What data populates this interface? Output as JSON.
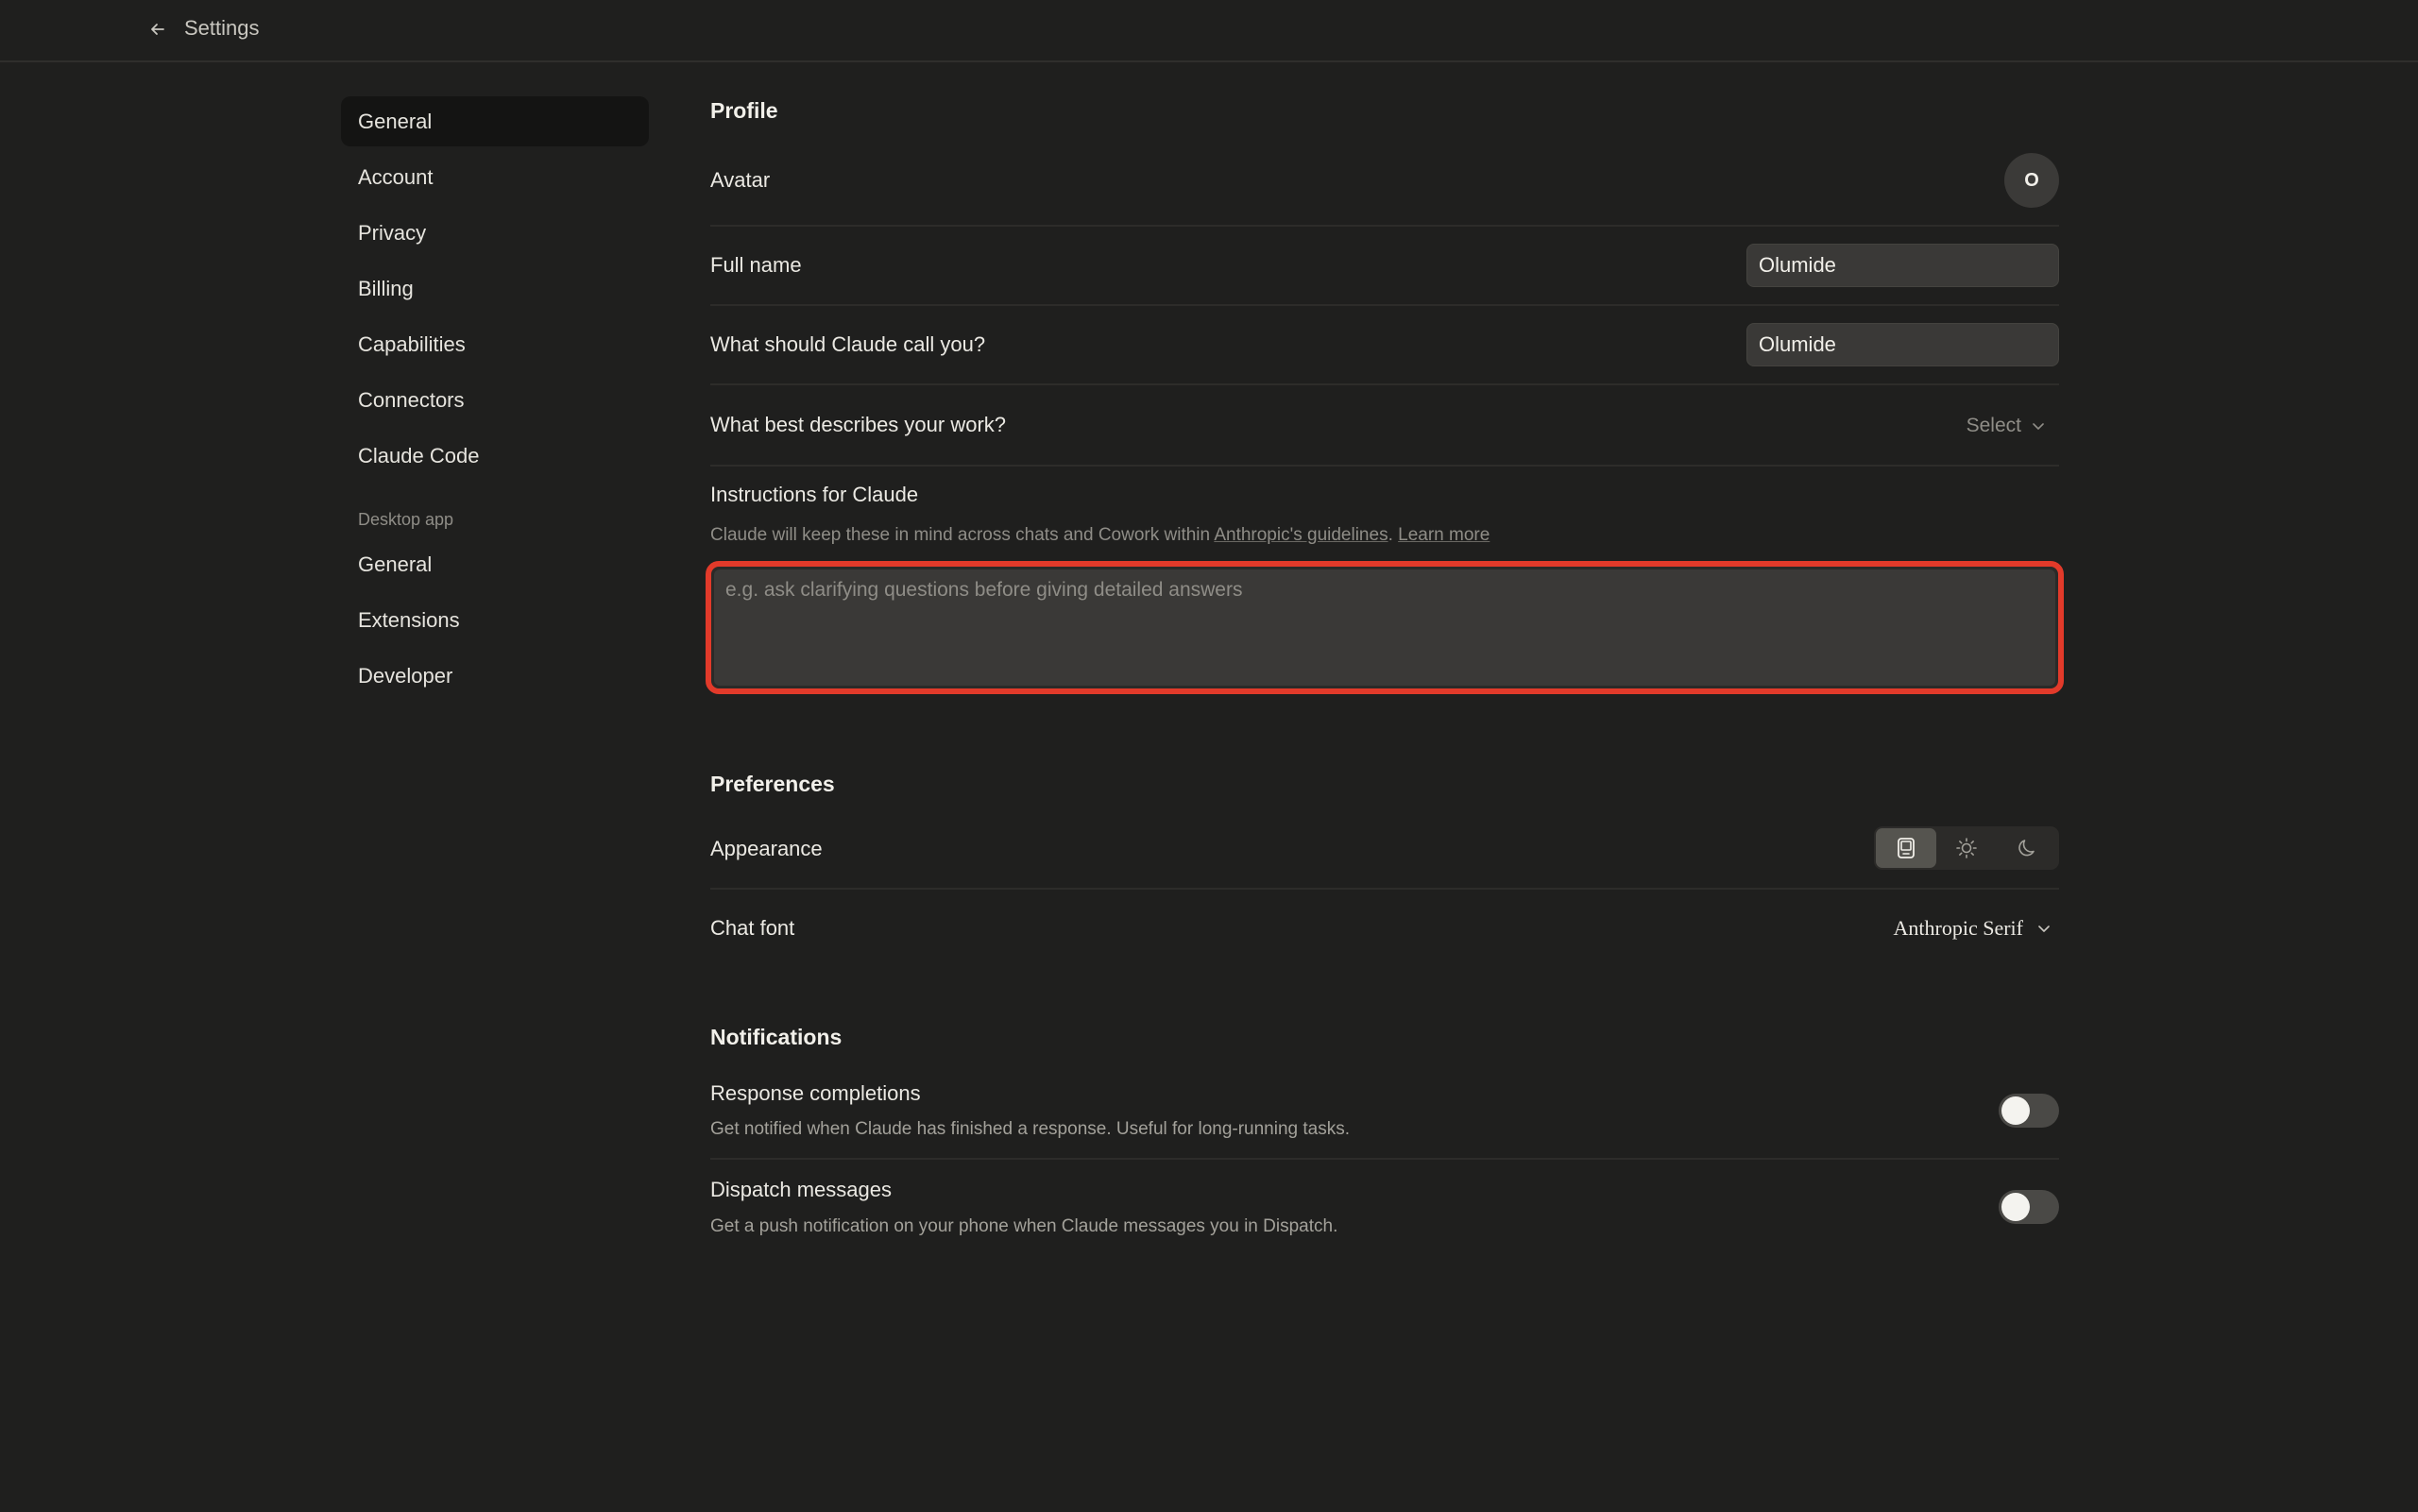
{
  "topbar": {
    "title": "Settings"
  },
  "sidebar": {
    "items": [
      {
        "label": "General"
      },
      {
        "label": "Account"
      },
      {
        "label": "Privacy"
      },
      {
        "label": "Billing"
      },
      {
        "label": "Capabilities"
      },
      {
        "label": "Connectors"
      },
      {
        "label": "Claude Code"
      }
    ],
    "desktop_section_label": "Desktop app",
    "desktop_items": [
      {
        "label": "General"
      },
      {
        "label": "Extensions"
      },
      {
        "label": "Developer"
      }
    ]
  },
  "profile": {
    "heading": "Profile",
    "avatar_label": "Avatar",
    "avatar_initial": "O",
    "full_name_label": "Full name",
    "full_name_value": "Olumide",
    "nickname_label": "What should Claude call you?",
    "nickname_value": "Olumide",
    "work_label": "What best describes your work?",
    "work_select": "Select",
    "instructions_label": "Instructions for Claude",
    "instructions_desc_prefix": "Claude will keep these in mind across chats and Cowork within ",
    "instructions_desc_link": "Anthropic's guidelines",
    "instructions_desc_sep": ". ",
    "instructions_learn_more": "Learn more",
    "instructions_placeholder": "e.g. ask clarifying questions before giving detailed answers",
    "instructions_highlight_color": "#e23a2a"
  },
  "preferences": {
    "heading": "Preferences",
    "appearance_label": "Appearance",
    "appearance_options": [
      "system-icon",
      "sun-icon",
      "moon-icon"
    ],
    "appearance_selected": "system-icon",
    "chat_font_label": "Chat font",
    "chat_font_value": "Anthropic Serif"
  },
  "notifications": {
    "heading": "Notifications",
    "response_title": "Response completions",
    "response_desc": "Get notified when Claude has finished a response. Useful for long-running tasks.",
    "response_enabled": false,
    "dispatch_title": "Dispatch messages",
    "dispatch_desc": "Get a push notification on your phone when Claude messages you in Dispatch.",
    "dispatch_enabled": false
  }
}
